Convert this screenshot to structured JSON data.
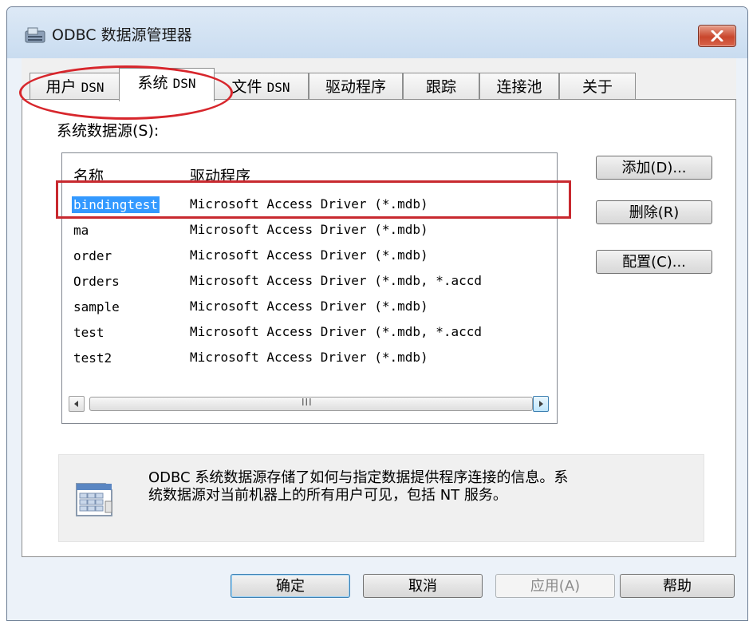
{
  "window": {
    "title": "ODBC 数据源管理器",
    "close_icon": "close-icon",
    "app_icon": "odbc-admin-icon"
  },
  "tabs": [
    {
      "label_cn": "用户",
      "label_mono": "DSN"
    },
    {
      "label_cn": "系统",
      "label_mono": "DSN",
      "active": true
    },
    {
      "label_cn": "文件",
      "label_mono": "DSN"
    },
    {
      "label_cn": "驱动程序",
      "label_mono": ""
    },
    {
      "label_cn": "跟踪",
      "label_mono": ""
    },
    {
      "label_cn": "连接池",
      "label_mono": ""
    },
    {
      "label_cn": "关于",
      "label_mono": ""
    }
  ],
  "datasources": {
    "label": "系统数据源(S):",
    "columns": [
      "名称",
      "驱动程序"
    ],
    "rows": [
      {
        "name": "bindingtest",
        "driver": "Microsoft Access Driver (*.mdb)",
        "selected": true
      },
      {
        "name": "ma",
        "driver": "Microsoft Access Driver (*.mdb)"
      },
      {
        "name": "order",
        "driver": "Microsoft Access Driver (*.mdb)"
      },
      {
        "name": "Orders",
        "driver": "Microsoft Access Driver (*.mdb, *.accd"
      },
      {
        "name": "sample",
        "driver": "Microsoft Access Driver (*.mdb)"
      },
      {
        "name": "test",
        "driver": "Microsoft Access Driver (*.mdb, *.accd"
      },
      {
        "name": "test2",
        "driver": "Microsoft Access Driver (*.mdb)"
      }
    ],
    "scroll_grip": "III"
  },
  "side_buttons": {
    "add": "添加(D)...",
    "remove": "删除(R)",
    "configure": "配置(C)..."
  },
  "info": {
    "line1": "ODBC 系统数据源存储了如何与指定数据提供程序连接的信息。系",
    "line2": "统数据源对当前机器上的所有用户可见，包括 NT 服务。",
    "icon": "datasource-table-icon"
  },
  "footer": {
    "ok": "确定",
    "cancel": "取消",
    "apply": "应用(A)",
    "help": "帮助"
  },
  "colors": {
    "accent_selection": "#3399ff",
    "annotation_red": "#d7262c",
    "close_red": "#c9462c"
  }
}
